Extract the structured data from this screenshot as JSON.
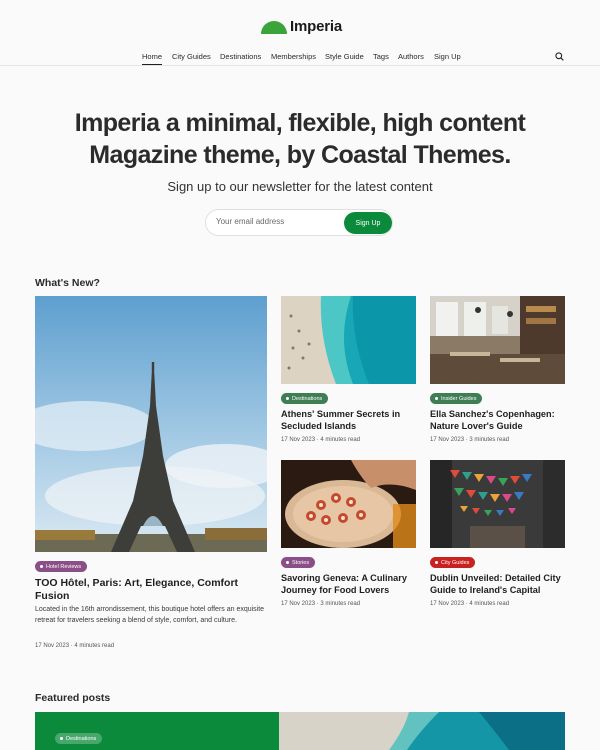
{
  "brand": {
    "name": "Imperia",
    "accent_color": "#0b8a3c",
    "logo_icon": "green-half-circle-logo"
  },
  "nav": {
    "items": [
      "Home",
      "City Guides",
      "Destinations",
      "Memberships",
      "Style Guide",
      "Tags",
      "Authors",
      "Sign Up"
    ],
    "active": "Home",
    "search_icon": "search-icon"
  },
  "hero": {
    "title_line1": "Imperia a minimal, flexible, high content",
    "title_line2": "Magazine theme, by Coastal Themes.",
    "subtitle": "Sign up to our newsletter for the latest content",
    "email_placeholder": "Your email address",
    "signup_label": "Sign Up"
  },
  "whats_new": {
    "title": "What's New?",
    "featured": {
      "tag": "Hotel Reviews",
      "tag_color": "#8a4f86",
      "title": "TOO Hôtel, Paris: Art, Elegance, Comfort Fusion",
      "excerpt": "Located in the 16th arrondissement, this boutique hotel offers an exquisite retreat for travelers seeking a blend of style, comfort, and culture.",
      "meta": "17 Nov 2023 · 4 minutes read",
      "image": "eiffel-tower-photo"
    },
    "cards": [
      {
        "tag": "Destinations",
        "tag_color": "#3f7d55",
        "title": "Athens' Summer Secrets in Secluded Islands",
        "meta": "17 Nov 2023 · 4 minutes read",
        "image": "beach-aerial-photo"
      },
      {
        "tag": "Insider Guides",
        "tag_color": "#3f7d55",
        "title": "Ella Sanchez's Copenhagen: Nature Lover's Guide",
        "meta": "17 Nov 2023 · 3 minutes read",
        "image": "restaurant-interior-photo"
      },
      {
        "tag": "Stories",
        "tag_color": "#8a4f86",
        "title": "Savoring Geneva: A Culinary Journey for Food Lovers",
        "meta": "17 Nov 2023 · 3 minutes read",
        "image": "food-platter-photo"
      },
      {
        "tag": "City Guides",
        "tag_color": "#c8211f",
        "title": "Dublin Unveiled: Detailed City Guide to Ireland's Capital",
        "meta": "17 Nov 2023 · 4 minutes read",
        "image": "street-flags-photo"
      }
    ]
  },
  "featured_posts": {
    "title": "Featured posts",
    "first_tag": "Destinations",
    "panel_color": "#0b8a3c"
  }
}
